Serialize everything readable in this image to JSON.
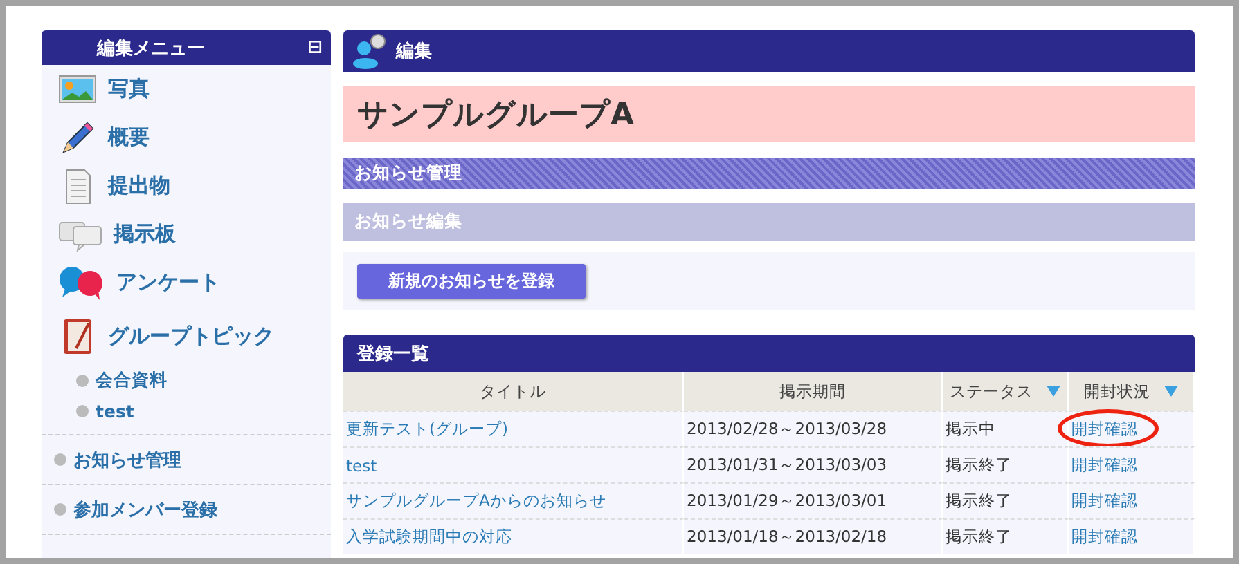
{
  "sidebar": {
    "title": "編集メニュー",
    "collapse_icon": "⊟",
    "items": [
      {
        "label": "写真",
        "kind": "photo"
      },
      {
        "label": "概要",
        "kind": "pencil"
      },
      {
        "label": "提出物",
        "kind": "document"
      },
      {
        "label": "掲示板",
        "kind": "bubbles"
      },
      {
        "label": "アンケート",
        "kind": "qa"
      },
      {
        "label": "グループトピック",
        "kind": "notebook",
        "children": [
          {
            "label": "会合資料"
          },
          {
            "label": "test"
          }
        ]
      }
    ],
    "links": [
      {
        "label": "お知らせ管理"
      },
      {
        "label": "参加メンバー登録"
      }
    ]
  },
  "main": {
    "header": "編集",
    "group_title": "サンプルグループA",
    "section": "お知らせ管理",
    "subsection": "お知らせ編集",
    "new_button": "新規のお知らせを登録",
    "list": {
      "title": "登録一覧",
      "columns": [
        {
          "label": "タイトル",
          "sortable": false
        },
        {
          "label": "掲示期間",
          "sortable": false
        },
        {
          "label": "ステータス",
          "sortable": true
        },
        {
          "label": "開封状況",
          "sortable": true
        }
      ],
      "rows": [
        {
          "title": "更新テスト(グループ)",
          "period": "2013/02/28～2013/03/28",
          "status": "掲示中",
          "open": "開封確認",
          "circled": true
        },
        {
          "title": "test",
          "period": "2013/01/31～2013/03/03",
          "status": "掲示終了",
          "open": "開封確認",
          "circled": false
        },
        {
          "title": "サンプルグループAからのお知らせ",
          "period": "2013/01/29～2013/03/01",
          "status": "掲示終了",
          "open": "開封確認",
          "circled": false
        },
        {
          "title": "入学試験期間中の対応",
          "period": "2013/01/18～2013/02/18",
          "status": "掲示終了",
          "open": "開封確認",
          "circled": false
        }
      ]
    }
  }
}
